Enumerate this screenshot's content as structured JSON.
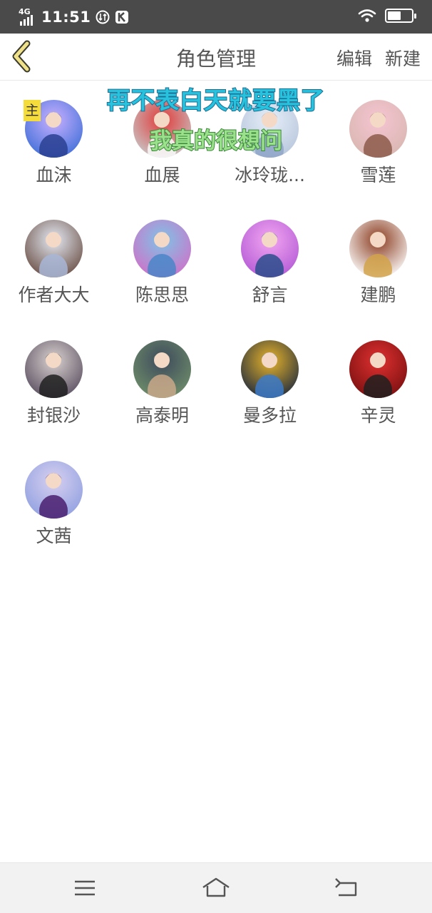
{
  "status_bar": {
    "network": "4G",
    "time": "11:51",
    "battery_level": 0.55
  },
  "header": {
    "title": "角色管理",
    "edit_label": "编辑",
    "new_label": "新建"
  },
  "overlay": {
    "line1": "再不表白天就要黑了",
    "line2": "我真的很想问"
  },
  "main_badge": "主",
  "characters": [
    {
      "name": "血沫",
      "avatar_colors": [
        "#3f6fd8",
        "#c9b0ff",
        "#2a3f90"
      ]
    },
    {
      "name": "血展",
      "avatar_colors": [
        "#c8c8c8",
        "#e03b3b",
        "#fafafa"
      ]
    },
    {
      "name": "冰玲珑...",
      "avatar_colors": [
        "#b7c6dc",
        "#e6eef8",
        "#8fa6c8"
      ]
    },
    {
      "name": "雪莲",
      "avatar_colors": [
        "#d8b7b0",
        "#f6c4d2",
        "#8c5a4a"
      ]
    },
    {
      "name": "作者大大",
      "avatar_colors": [
        "#6a4e44",
        "#e4eaf4",
        "#a8b6d6"
      ]
    },
    {
      "name": "陈思思",
      "avatar_colors": [
        "#d070c8",
        "#7fc3e6",
        "#4a86c8"
      ]
    },
    {
      "name": "舒言",
      "avatar_colors": [
        "#b35ad6",
        "#f2a6f0",
        "#2b4d8c"
      ]
    },
    {
      "name": "建鹏",
      "avatar_colors": [
        "#ffffff",
        "#8a3b1e",
        "#d2a34a"
      ]
    },
    {
      "name": "封银沙",
      "avatar_colors": [
        "#5a4e60",
        "#d9d2d0",
        "#202020"
      ]
    },
    {
      "name": "高泰明",
      "avatar_colors": [
        "#6f8f6a",
        "#3e4a5c",
        "#c9a88a"
      ]
    },
    {
      "name": "曼多拉",
      "avatar_colors": [
        "#1e2a3e",
        "#e8b42a",
        "#3c7ac8"
      ]
    },
    {
      "name": "辛灵",
      "avatar_colors": [
        "#7a1010",
        "#e03030",
        "#202020"
      ]
    },
    {
      "name": "文茜",
      "avatar_colors": [
        "#8fa0e0",
        "#d8d0f0",
        "#4a1f6e"
      ]
    }
  ],
  "nav": {
    "menu_icon": "menu-icon",
    "home_icon": "home-icon",
    "back_icon": "back-arrow-icon"
  }
}
